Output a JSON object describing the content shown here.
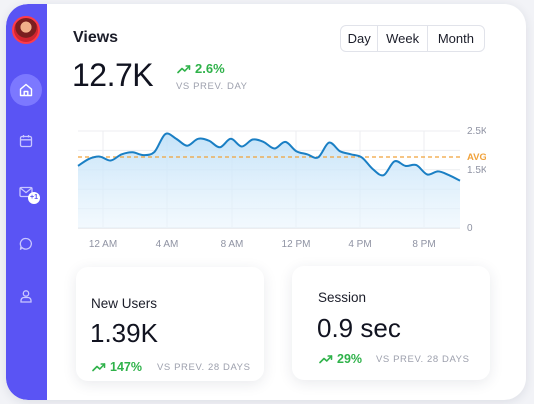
{
  "sidebar": {
    "items": [
      {
        "icon": "home-icon",
        "active": true
      },
      {
        "icon": "calendar-icon"
      },
      {
        "icon": "mail-icon",
        "badge": "+1"
      },
      {
        "icon": "chat-icon"
      },
      {
        "icon": "user-icon"
      }
    ]
  },
  "views": {
    "title": "Views",
    "value": "12.7K",
    "change": "2.6%",
    "compare": "VS PREV. DAY"
  },
  "range_selector": {
    "options": [
      "Day",
      "Week",
      "Month"
    ],
    "selected": "Day"
  },
  "colors": {
    "accent": "#5a54f4",
    "line": "#1a7fc4",
    "avg": "#f0a23b",
    "positive": "#2fb24a"
  },
  "chart_data": {
    "type": "area",
    "x_ticks": [
      "12 AM",
      "4 AM",
      "8 AM",
      "12 PM",
      "4 PM",
      "8 PM"
    ],
    "y_ticks": [
      "0",
      "1.5K",
      "2.5K"
    ],
    "avg_label": "AVG",
    "ylim": [
      0,
      2.5
    ],
    "avg": 1.83,
    "grid": true,
    "values": [
      1.6,
      1.78,
      1.84,
      1.74,
      1.9,
      1.95,
      1.88,
      1.96,
      2.42,
      2.3,
      2.12,
      2.3,
      2.25,
      2.08,
      2.3,
      2.1,
      2.28,
      2.22,
      2.05,
      2.22,
      1.98,
      1.9,
      1.82,
      2.2,
      1.98,
      1.9,
      1.82,
      1.52,
      1.36,
      1.72,
      1.6,
      1.62,
      1.38,
      1.46,
      1.36,
      1.22
    ]
  },
  "cards": {
    "new_users": {
      "title": "New Users",
      "value": "1.39K",
      "change": "147%",
      "compare": "VS PREV. 28 DAYS"
    },
    "session": {
      "title": "Session",
      "value": "0.9 sec",
      "change": "29%",
      "compare": "VS PREV. 28 DAYS"
    }
  }
}
